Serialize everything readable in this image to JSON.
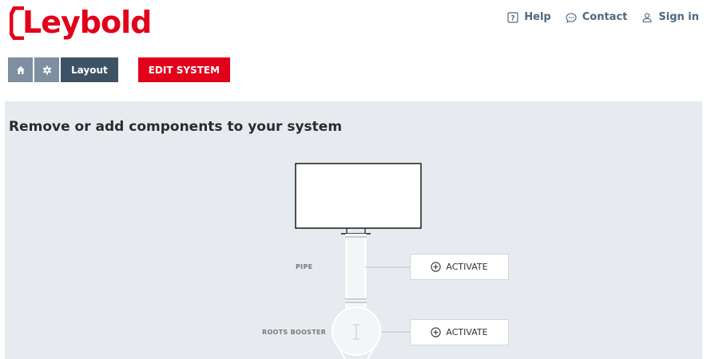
{
  "brand": {
    "name": "Leybold",
    "color": "#e2001a"
  },
  "header": {
    "links": [
      {
        "label": "Help",
        "icon": "help-icon"
      },
      {
        "label": "Contact",
        "icon": "chat-icon"
      },
      {
        "label": "Sign in",
        "icon": "user-icon"
      }
    ]
  },
  "toolbar": {
    "home_icon": "home-icon",
    "settings_icon": "gear-icon",
    "layout_label": "Layout",
    "edit_label": "EDIT SYSTEM"
  },
  "main": {
    "title": "Remove or add components to your system",
    "components": [
      {
        "label": "PIPE",
        "action": "ACTIVATE"
      },
      {
        "label": "ROOTS BOOSTER",
        "action": "ACTIVATE"
      }
    ]
  }
}
